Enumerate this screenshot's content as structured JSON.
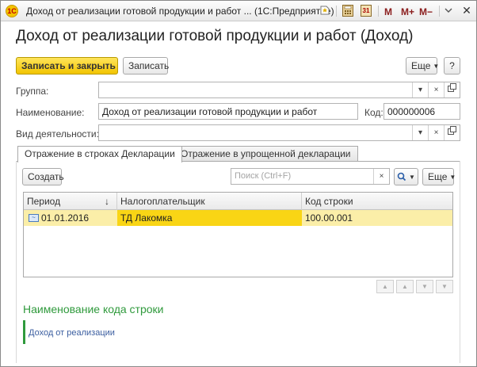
{
  "window": {
    "title": "Доход от реализации готовой продукции и работ ... (1С:Предприятие)",
    "logo_text": "1С",
    "m_label": "M",
    "mplus_label": "M+",
    "mminus_label": "M−",
    "close_label": "✕"
  },
  "form": {
    "title": "Доход от реализации готовой продукции и работ (Доход)"
  },
  "toolbar": {
    "save_close_label": "Записать и закрыть",
    "save_label": "Записать",
    "more_label": "Еще",
    "help_label": "?"
  },
  "fields": {
    "group": {
      "label": "Группа:",
      "value": ""
    },
    "name": {
      "label": "Наименование:",
      "value": "Доход от реализации готовой продукции и работ"
    },
    "code": {
      "label": "Код:",
      "value": "000000006"
    },
    "activity": {
      "label": "Вид деятельности:",
      "value": ""
    }
  },
  "tabs": [
    {
      "label": "Отражение в строках Декларации",
      "active": true
    },
    {
      "label": "Отражение в упрощенной декларации",
      "active": false
    }
  ],
  "panel": {
    "create_label": "Создать",
    "search_placeholder": "Поиск (Ctrl+F)",
    "more_label": "Еще"
  },
  "table": {
    "columns": [
      "Период",
      "Налогоплательщик",
      "Код строки"
    ],
    "rows": [
      {
        "period": "01.01.2016",
        "taxpayer": "ТД Лакомка",
        "code": "100.00.001"
      }
    ]
  },
  "section": {
    "title": "Наименование кода строки",
    "text": "Доход от реализации"
  },
  "colors": {
    "accent_yellow": "#f2c400",
    "selection": "#f9d515",
    "row_highlight": "#fbeea8",
    "section_green": "#2f9a3c",
    "link_blue": "#3b5ea0"
  }
}
